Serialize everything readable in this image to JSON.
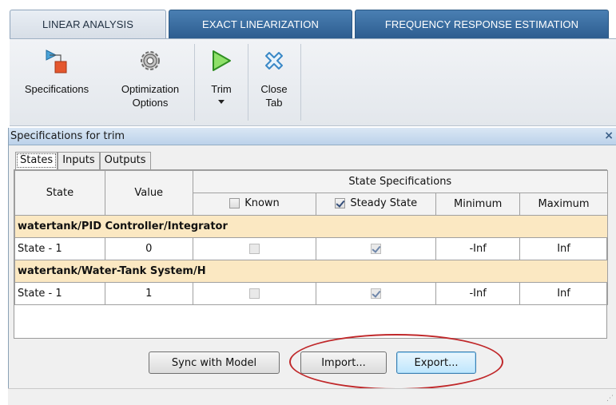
{
  "top_tabs": [
    "LINEAR ANALYSIS",
    "EXACT LINEARIZATION",
    "FREQUENCY RESPONSE ESTIMATION"
  ],
  "toolbar": {
    "specifications": "Specifications",
    "optimization_line1": "Optimization",
    "optimization_line2": "Options",
    "trim": "Trim",
    "close_line1": "Close",
    "close_line2": "Tab"
  },
  "panel": {
    "title": "Specifications for trim",
    "close_glyph": "×"
  },
  "sub_tabs": [
    "States",
    "Inputs",
    "Outputs"
  ],
  "table": {
    "col_state": "State",
    "col_value": "Value",
    "group_header": "State Specifications",
    "col_known": "Known",
    "col_steady": "Steady State",
    "col_min": "Minimum",
    "col_max": "Maximum",
    "header_known_checked": false,
    "header_steady_checked": true,
    "groups": [
      {
        "name": "watertank/PID Controller/Integrator",
        "rows": [
          {
            "state": "State - 1",
            "value": "0",
            "known": false,
            "steady": true,
            "minimum": "-Inf",
            "maximum": "Inf"
          }
        ]
      },
      {
        "name": "watertank/Water-Tank System/H",
        "rows": [
          {
            "state": "State - 1",
            "value": "1",
            "known": false,
            "steady": true,
            "minimum": "-Inf",
            "maximum": "Inf"
          }
        ]
      }
    ]
  },
  "buttons": {
    "sync": "Sync with Model",
    "import": "Import...",
    "export": "Export..."
  },
  "colors": {
    "tab_blue": "#2d5d8f",
    "group_row": "#fbe8c2",
    "annotation_red": "#c0282a"
  }
}
